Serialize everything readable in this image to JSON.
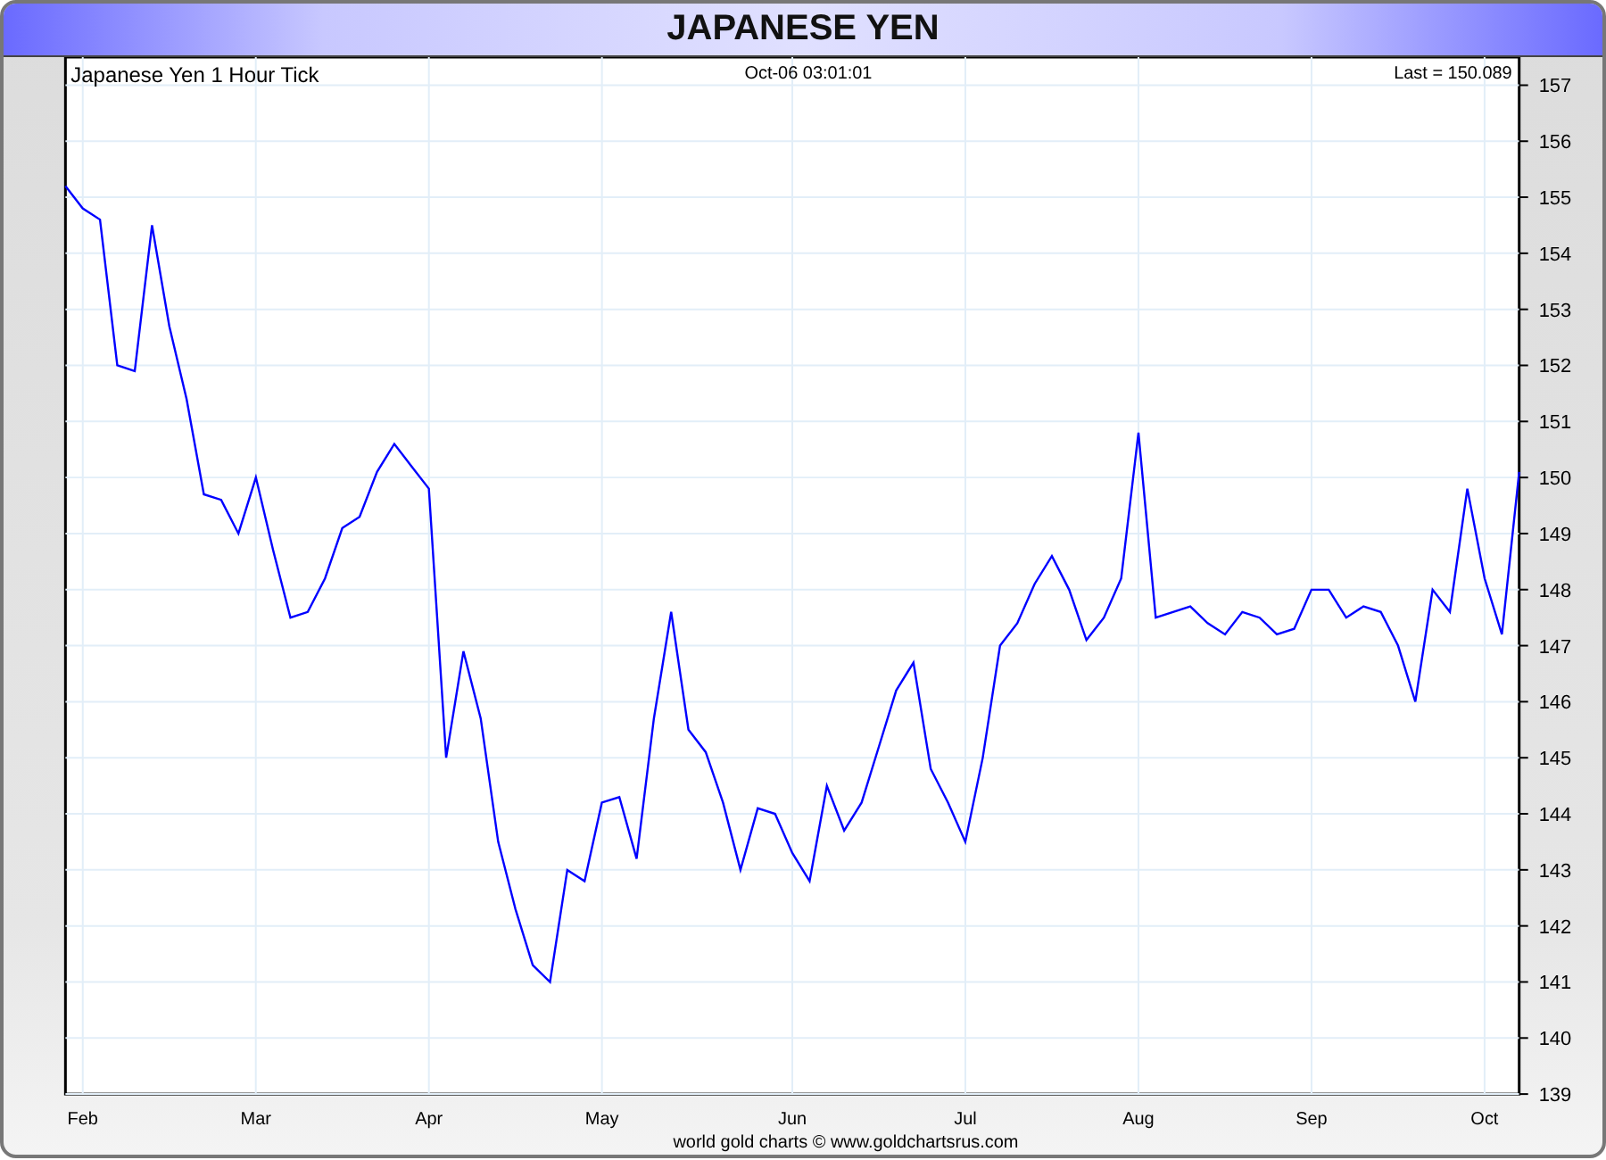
{
  "window": {
    "title": "JAPANESE YEN"
  },
  "chart_data": {
    "type": "line",
    "title": "Japanese Yen 1 Hour Tick",
    "categories": [
      null,
      "Feb",
      null,
      null,
      null,
      null,
      null,
      null,
      null,
      null,
      null,
      "Mar",
      null,
      null,
      null,
      null,
      null,
      null,
      null,
      null,
      null,
      "Apr",
      null,
      null,
      null,
      null,
      null,
      null,
      null,
      null,
      null,
      "May",
      null,
      null,
      null,
      null,
      null,
      null,
      null,
      null,
      null,
      null,
      "Jun",
      null,
      null,
      null,
      null,
      null,
      null,
      null,
      null,
      null,
      "Jul",
      null,
      null,
      null,
      null,
      null,
      null,
      null,
      null,
      null,
      "Aug",
      null,
      null,
      null,
      null,
      null,
      null,
      null,
      null,
      null,
      "Sep",
      null,
      null,
      null,
      null,
      null,
      null,
      null,
      null,
      null,
      "Oct",
      null,
      null
    ],
    "series": [
      {
        "color": "#0000ff",
        "values": [
          155.2,
          154.8,
          154.6,
          152.0,
          151.9,
          154.5,
          152.7,
          151.4,
          149.7,
          149.6,
          149.0,
          150.0,
          148.7,
          147.5,
          147.6,
          148.2,
          149.1,
          149.3,
          150.1,
          150.6,
          150.2,
          149.8,
          145.0,
          146.9,
          145.7,
          143.5,
          142.3,
          141.3,
          141.0,
          143.0,
          142.8,
          144.2,
          144.3,
          143.2,
          145.7,
          147.6,
          145.5,
          145.1,
          144.2,
          143.0,
          144.1,
          144.0,
          143.3,
          142.8,
          144.5,
          143.7,
          144.2,
          145.2,
          146.2,
          146.7,
          144.8,
          144.2,
          143.5,
          145.0,
          147.0,
          147.4,
          148.1,
          148.6,
          148.0,
          147.1,
          147.5,
          148.2,
          150.8,
          147.5,
          147.6,
          147.7,
          147.4,
          147.2,
          147.6,
          147.5,
          147.2,
          147.3,
          148.0,
          148.0,
          147.5,
          147.7,
          147.6,
          147.0,
          146.0,
          148.0,
          147.6,
          149.8,
          148.2,
          147.2,
          150.1
        ]
      }
    ],
    "ylim": [
      139,
      157.5
    ],
    "grid": true,
    "yticks": [
      139,
      140,
      141,
      142,
      143,
      144,
      145,
      146,
      147,
      148,
      149,
      150,
      151,
      152,
      153,
      154,
      155,
      156,
      157
    ],
    "annotations": [
      {
        "text": "Oct-06  03:01:01"
      },
      {
        "text": "Last = 150.089"
      }
    ]
  },
  "footer": "world gold charts © www.goldchartsrus.com"
}
